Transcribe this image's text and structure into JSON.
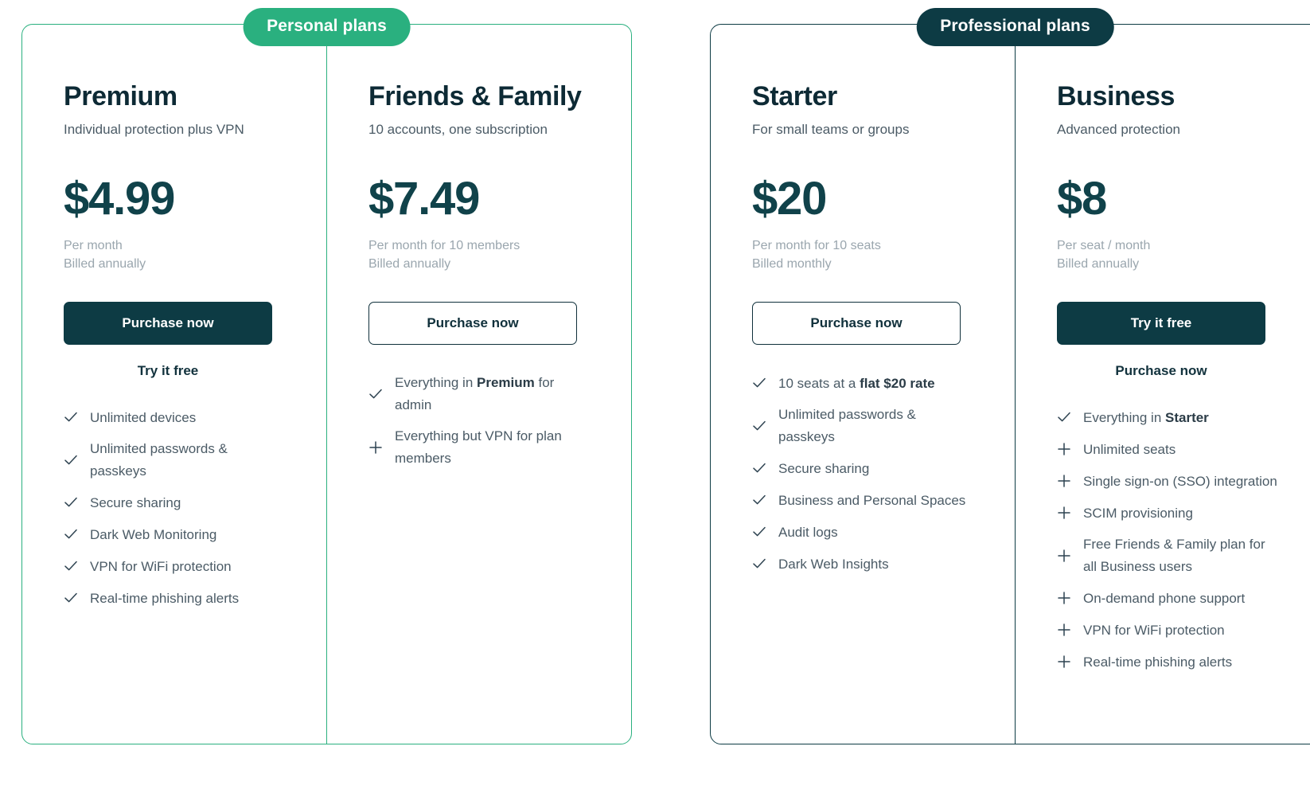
{
  "cards": [
    {
      "badge": "Personal plans",
      "badge_color": "#2ab07f",
      "border_color": "#2ab07f",
      "plans": [
        {
          "name": "Premium",
          "tagline": "Individual protection plus VPN",
          "price": "$4.99",
          "price_note_line1": "Per month",
          "price_note_line2": "Billed annually",
          "button_label": "Purchase now",
          "button_style": "solid",
          "sub_link": "Try it free",
          "features": [
            {
              "icon": "check-icon",
              "text": "Unlimited devices"
            },
            {
              "icon": "check-icon",
              "text": "Unlimited passwords & passkeys"
            },
            {
              "icon": "check-icon",
              "text": "Secure sharing"
            },
            {
              "icon": "check-icon",
              "text": "Dark Web Monitoring"
            },
            {
              "icon": "check-icon",
              "text": "VPN for WiFi protection"
            },
            {
              "icon": "check-icon",
              "text": "Real-time phishing alerts"
            }
          ]
        },
        {
          "name": "Friends & Family",
          "tagline": "10 accounts, one subscription",
          "price": "$7.49",
          "price_note_line1": "Per month for 10 members",
          "price_note_line2": "Billed annually",
          "button_label": "Purchase now",
          "button_style": "outline",
          "sub_link": "",
          "features": [
            {
              "icon": "check-icon",
              "text_html": "Everything in <b>Premium</b> for admin"
            },
            {
              "icon": "plus-icon",
              "text": "Everything but VPN for plan members"
            }
          ]
        }
      ]
    },
    {
      "badge": "Professional plans",
      "badge_color": "#0d3b44",
      "border_color": "#0d3b44",
      "plans": [
        {
          "name": "Starter",
          "tagline": "For small teams or groups",
          "price": "$20",
          "price_note_line1": "Per month for 10 seats",
          "price_note_line2": "Billed monthly",
          "button_label": "Purchase now",
          "button_style": "outline",
          "sub_link": "",
          "features": [
            {
              "icon": "check-icon",
              "text_html": "10 seats at a <b>flat $20 rate</b>"
            },
            {
              "icon": "check-icon",
              "text": "Unlimited passwords & passkeys"
            },
            {
              "icon": "check-icon",
              "text": "Secure sharing"
            },
            {
              "icon": "check-icon",
              "text": "Business and Personal Spaces"
            },
            {
              "icon": "check-icon",
              "text": "Audit logs"
            },
            {
              "icon": "check-icon",
              "text": "Dark Web Insights"
            }
          ]
        },
        {
          "name": "Business",
          "tagline": "Advanced protection",
          "price": "$8",
          "price_note_line1": "Per seat / month",
          "price_note_line2": "Billed annually",
          "button_label": "Try it free",
          "button_style": "solid",
          "sub_link": "Purchase now",
          "features": [
            {
              "icon": "check-icon",
              "text_html": "Everything in <b>Starter</b>"
            },
            {
              "icon": "plus-icon",
              "text": "Unlimited seats"
            },
            {
              "icon": "plus-icon",
              "text": "Single sign-on (SSO) integration"
            },
            {
              "icon": "plus-icon",
              "text": "SCIM provisioning"
            },
            {
              "icon": "plus-icon",
              "text": "Free Friends & Family plan for all Business users"
            },
            {
              "icon": "plus-icon",
              "text": "On-demand phone support"
            },
            {
              "icon": "plus-icon",
              "text": "VPN for WiFi protection"
            },
            {
              "icon": "plus-icon",
              "text": "Real-time phishing alerts"
            }
          ]
        }
      ]
    }
  ]
}
